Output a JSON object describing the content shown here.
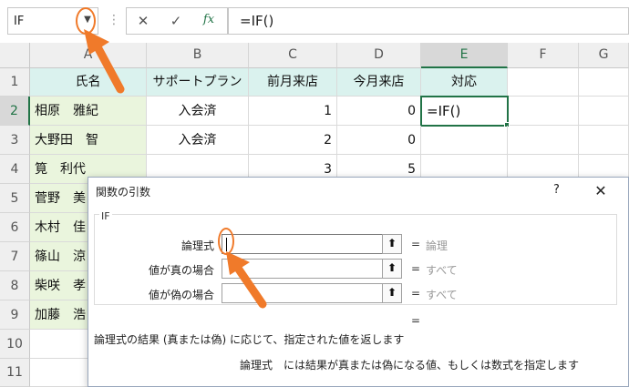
{
  "formula_bar": {
    "name_box": "IF",
    "name_box_dropdown": "▼",
    "separator": "⋮",
    "cancel_icon": "✕",
    "enter_icon": "✓",
    "fx_icon": "fx",
    "formula": "=IF()"
  },
  "columns": [
    "A",
    "B",
    "C",
    "D",
    "E",
    "F",
    "G"
  ],
  "rows": [
    "1",
    "2",
    "3",
    "4",
    "5",
    "6",
    "7",
    "8",
    "9",
    "10",
    "11"
  ],
  "cells": {
    "A1": "氏名",
    "B1": "サポートプラン",
    "C1": "前月来店",
    "D1": "今月来店",
    "E1": "対応",
    "A2": "相原　雅紀",
    "B2": "入会済",
    "C2": "1",
    "D2": "0",
    "E2": "=IF()",
    "A3": "大野田　智",
    "B3": "入会済",
    "C3": "2",
    "D3": "0",
    "A4": "筧　利代",
    "C4": "3",
    "D4": "5",
    "A5": "菅野　美",
    "A6": "木村　佳",
    "A7": "篠山　涼",
    "A8": "柴咲　孝",
    "A9": "加藤　浩"
  },
  "dialog": {
    "title": "関数の引数",
    "help": "?",
    "close": "✕",
    "function_name": "IF",
    "arguments": [
      {
        "label": "論理式",
        "value": "",
        "equals": "=",
        "hint": "論理"
      },
      {
        "label": "値が真の場合",
        "value": "",
        "equals": "=",
        "hint": "すべて"
      },
      {
        "label": "値が偽の場合",
        "value": "",
        "equals": "=",
        "hint": "すべて"
      }
    ],
    "ref_button": "⬆",
    "result_equals": "=",
    "description": "論理式の結果 (真または偽) に応じて、指定された値を返します",
    "arg_description": "論理式　には結果が真または偽になる値、もしくは数式を指定します"
  },
  "annotation_color": "#f07a2a"
}
